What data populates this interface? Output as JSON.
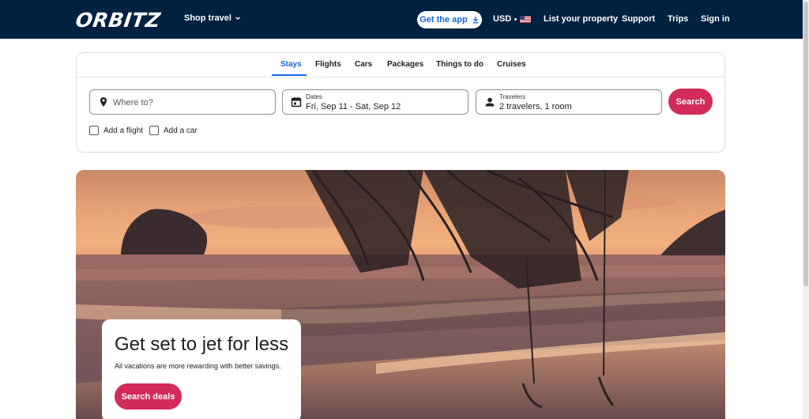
{
  "header": {
    "logo": "ORBITZ",
    "shop_travel": "Shop travel",
    "get_app": "Get the app",
    "currency": "USD",
    "list_property": "List your property",
    "support": "Support",
    "trips": "Trips",
    "sign_in": "Sign in",
    "bg_color": "#002140"
  },
  "search": {
    "tabs": [
      {
        "label": "Stays",
        "active": true
      },
      {
        "label": "Flights",
        "active": false
      },
      {
        "label": "Cars",
        "active": false
      },
      {
        "label": "Packages",
        "active": false
      },
      {
        "label": "Things to do",
        "active": false
      },
      {
        "label": "Cruises",
        "active": false
      }
    ],
    "where_placeholder": "Where to?",
    "dates_label": "Dates",
    "dates_value": "Fri, Sep 11 - Sat, Sep 12",
    "travelers_label": "Travelers",
    "travelers_value": "2 travelers, 1 room",
    "search_button": "Search",
    "add_flight": "Add a flight",
    "add_car": "Add a car",
    "accent_color": "#d22b5a",
    "link_color": "#1668e3"
  },
  "hero": {
    "title": "Get set to jet for less",
    "subtitle": "All vacations are more rewarding with better savings.",
    "cta": "Search deals"
  }
}
